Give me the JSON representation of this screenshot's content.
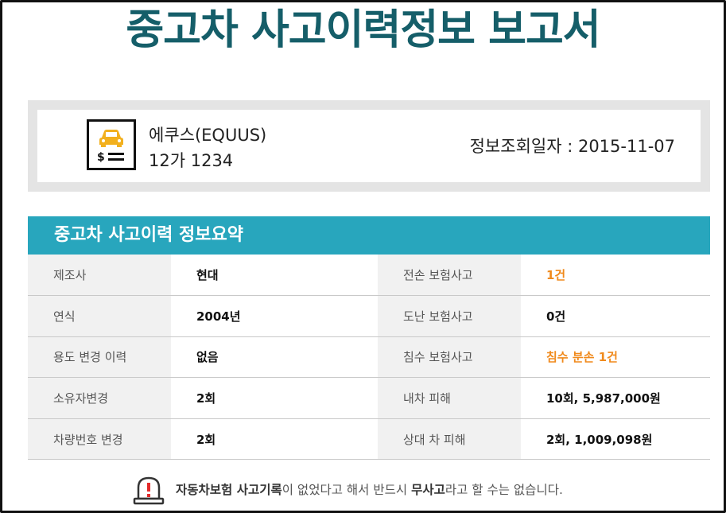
{
  "title": "중고차 사고이력정보 보고서",
  "vehicle": {
    "name": "에쿠스(EQUUS)",
    "plate": "12가 1234",
    "query_date_label": "정보조회일자 : 2015-11-07"
  },
  "summary": {
    "header": "중고차 사고이력 정보요약",
    "rows": [
      {
        "left_label": "제조사",
        "left_value": "현대",
        "right_label": "전손 보험사고",
        "right_value": "1건"
      },
      {
        "left_label": "연식",
        "left_value": "2004년",
        "right_label": "도난 보험사고",
        "right_value": "0건"
      },
      {
        "left_label": "용도 변경 이력",
        "left_value": "없음",
        "right_label": "침수 보험사고",
        "right_value": "침수 분손 1건"
      },
      {
        "left_label": "소유자변경",
        "left_value": "2회",
        "right_label": "내차 피해",
        "right_value": "10회, 5,987,000원"
      },
      {
        "left_label": "차량번호 변경",
        "left_value": "2회",
        "right_label": "상대 차 피해",
        "right_value": "2회, 1,009,098원"
      }
    ]
  },
  "notice": {
    "part1": "자동차보험 사고기록",
    "part2": "이 없었다고 해서 반드시 ",
    "part3": "무사고",
    "part4": "라고 할 수는 없습니다."
  },
  "icons": {
    "car_logo": "car-money-icon",
    "notice": "warning-icon"
  },
  "colors": {
    "title": "#155e69",
    "header_bg": "#28a6bd",
    "highlight": "#f08a1c",
    "car_icon": "#f2b01e"
  }
}
